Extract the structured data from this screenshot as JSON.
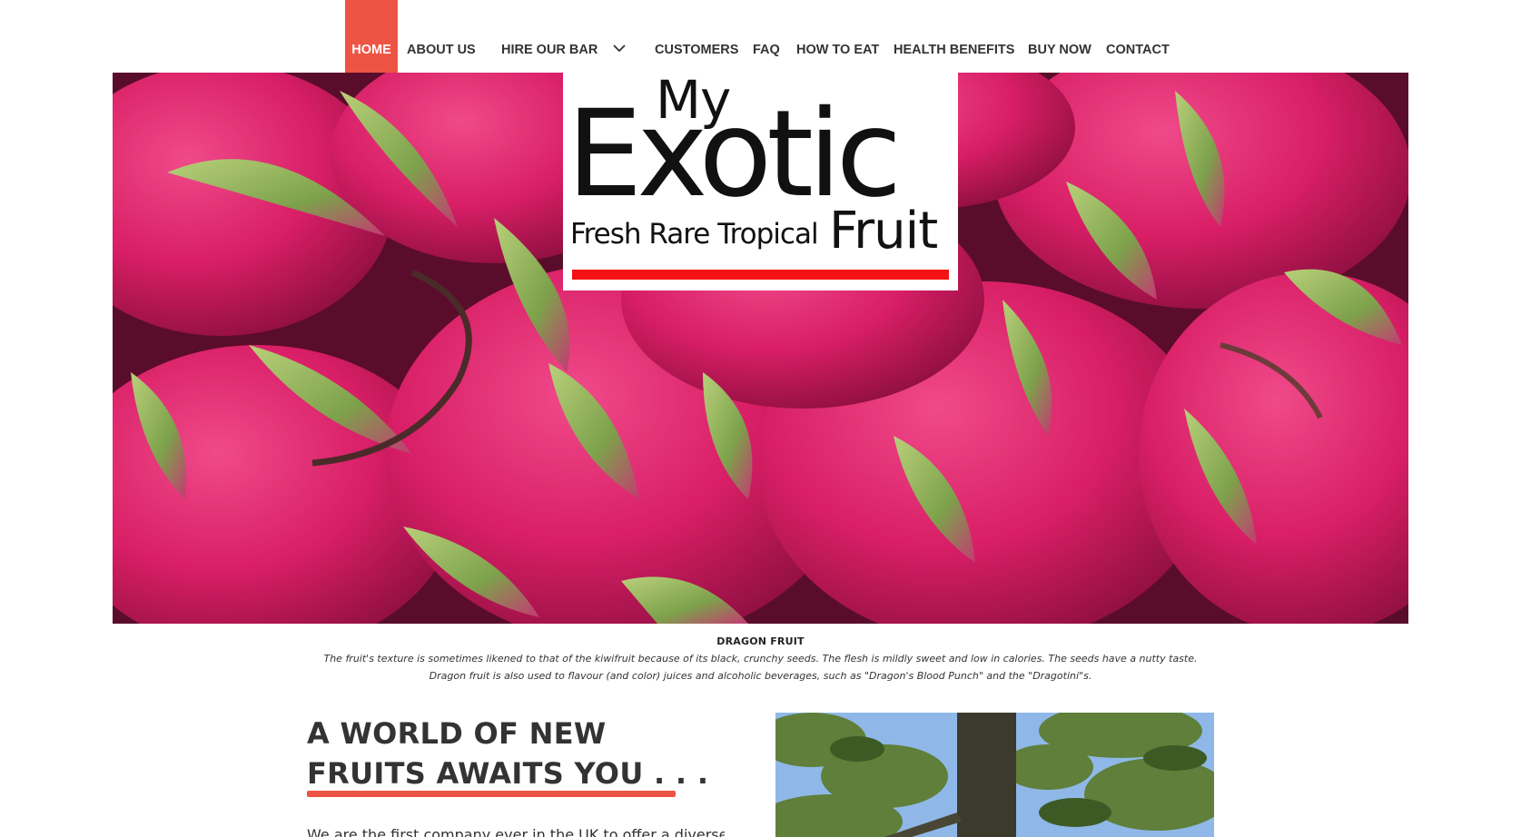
{
  "nav": {
    "items": [
      {
        "label": "HOME",
        "active": true
      },
      {
        "label": "ABOUT US"
      },
      {
        "label": "HIRE OUR BAR",
        "has_dropdown": true
      },
      {
        "label": "CUSTOMERS"
      },
      {
        "label": "FAQ"
      },
      {
        "label": "HOW TO EAT"
      },
      {
        "label": "HEALTH BENEFITS"
      },
      {
        "label": "BUY NOW"
      },
      {
        "label": "CONTACT"
      }
    ],
    "dropdown_icon": "chevron-down-icon"
  },
  "logo": {
    "my": "My",
    "exotic": "Exotic",
    "tagline": "Fresh Rare Tropical",
    "fruit": "Fruit"
  },
  "hero": {
    "image_subject": "dragon fruit pile"
  },
  "caption": {
    "title": "DRAGON FRUIT",
    "line1": "The fruit's texture is sometimes likened to that of the kiwifruit because of its black, crunchy seeds. The flesh is mildly sweet and low in calories. The seeds have a nutty taste.",
    "line2": "Dragon fruit is also used to flavour (and color) juices and alcoholic beverages, such as \"Dragon's Blood Punch\" and the \"Dragotini\"s."
  },
  "section": {
    "heading_line1": "A WORLD OF NEW",
    "heading_line2": "FRUITS AWAITS YOU . . .",
    "intro": "We are the first company ever in the UK to offer a diverse range of"
  },
  "colors": {
    "accent": "#ee5443",
    "logo_bar": "#f51214",
    "fruit_pink": "#d81e66",
    "leaf_green": "#8fb35a"
  }
}
